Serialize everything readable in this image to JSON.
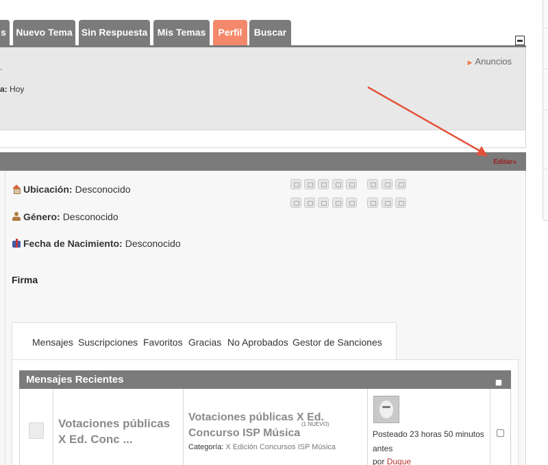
{
  "tabs": [
    {
      "label": "s",
      "active": false
    },
    {
      "label": "Nuevo Tema",
      "active": false
    },
    {
      "label": "Sin Respuesta",
      "active": false
    },
    {
      "label": "Mis Temas",
      "active": false
    },
    {
      "label": "Perfil",
      "active": true
    },
    {
      "label": "Buscar",
      "active": false
    }
  ],
  "info": {
    "line1": ".",
    "line2_label": "a:",
    "line2_value": "Hoy",
    "anuncios": "Anuncios"
  },
  "profile": {
    "edit_link": "Editar»",
    "fields": [
      {
        "label": "Ubicación:",
        "value": "Desconocido",
        "icon": "house-icon"
      },
      {
        "label": "Género:",
        "value": "Desconocido",
        "icon": "gender-icon"
      },
      {
        "label": "Fecha de Nacimiento:",
        "value": "Desconocido",
        "icon": "gift-icon"
      }
    ],
    "signature_label": "Firma"
  },
  "subtabs": [
    "Mensajes",
    "Suscripciones",
    "Favoritos",
    "Gracias",
    "No Aprobados",
    "Gestor de Sanciones"
  ],
  "recent": {
    "title": "Mensajes Recientes",
    "row": {
      "topic": "Votaciones públicas X Ed. Conc ...",
      "post_title": "Votaciones públicas X Ed. Concurso ISP Música",
      "new_badge": "(1 NUEVO)",
      "category_label": "Categoría:",
      "category_value": "X Edición Concursos ISP Música",
      "posted": "Posteado 23 horas 50 minutos antes",
      "by_label": "por",
      "user": "Duque"
    }
  },
  "colors": {
    "tab_gray": "#7b7b7b",
    "tab_active": "#f3886a",
    "edit_link": "#9b1d1d",
    "arrow": "#e4513a"
  }
}
